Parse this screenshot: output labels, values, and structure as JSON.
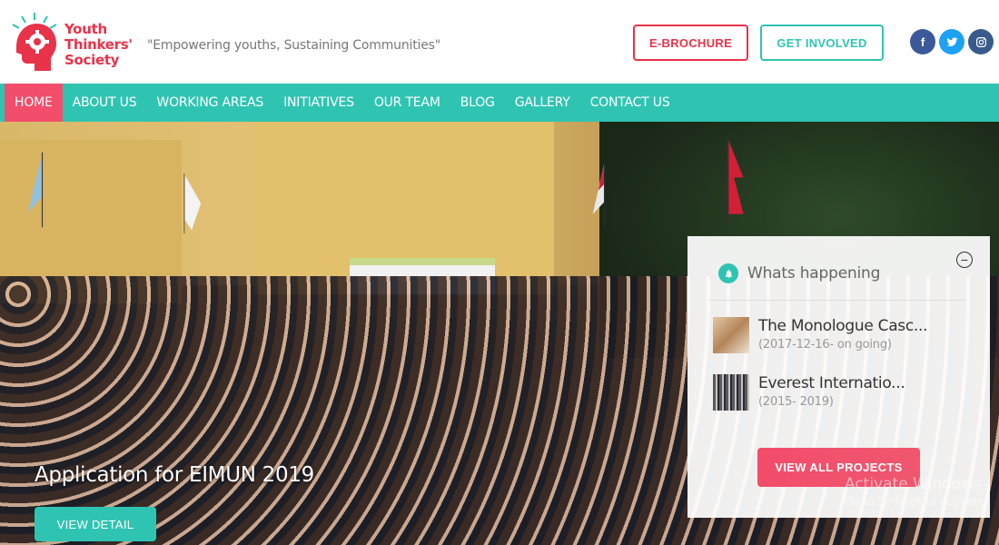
{
  "header": {
    "brand_lines": [
      "Youth",
      "Thinkers'",
      "Society"
    ],
    "tagline": "\"Empowering youths, Sustaining Communities\"",
    "brochure_label": "E-BROCHURE",
    "involved_label": "GET INVOLVED",
    "social": [
      {
        "icon": "facebook-icon",
        "glyph": "f",
        "color": "#3b5998"
      },
      {
        "icon": "twitter-icon",
        "glyph": "t",
        "color": "#1da1f2"
      },
      {
        "icon": "instagram-icon",
        "glyph": "◎",
        "color": "#3a5a8c"
      }
    ]
  },
  "nav": {
    "items": [
      {
        "label": "HOME",
        "active": true
      },
      {
        "label": "ABOUT US"
      },
      {
        "label": "WORKING AREAS"
      },
      {
        "label": "INITIATIVES"
      },
      {
        "label": "OUR TEAM"
      },
      {
        "label": "BLOG"
      },
      {
        "label": "GALLERY"
      },
      {
        "label": "CONTACT US"
      }
    ]
  },
  "hero": {
    "title": "Application for EIMUN 2019",
    "detail_label": "VIEW DETAIL"
  },
  "panel": {
    "title": "Whats happening",
    "projects": [
      {
        "name": "The Monologue Casc...",
        "date": "(2017-12-16- on going)"
      },
      {
        "name": "Everest Internatio...",
        "date": "(2015- 2019)"
      }
    ],
    "view_all_label": "VIEW ALL PROJECTS"
  },
  "watermark": {
    "line1": "Activate Windows",
    "line2": "Go to Settings to activate"
  },
  "colors": {
    "primary_teal": "#2fc4b2",
    "accent_pink": "#f24d6b",
    "brand_red": "#e8334a"
  }
}
